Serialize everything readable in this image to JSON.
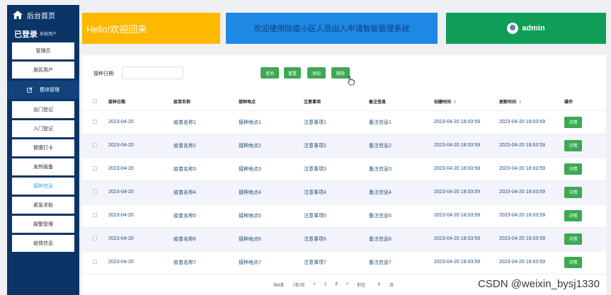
{
  "sidebar": {
    "home_label": "后台首页",
    "user_name": "已登录",
    "user_role": "系统用户",
    "items_top": [
      "管理员",
      "居民用户"
    ],
    "group_label": "模块管理",
    "items": [
      "出门登记",
      "入门登记",
      "健康打卡",
      "发热报备",
      "接种信息",
      "紧急求助",
      "报警管理",
      "疫情信息"
    ],
    "active_item": "接种信息"
  },
  "banners": {
    "hello": "Hello!欢迎回来",
    "welcome": "欢迎使用防疫小区人员出入申请智能管理系统",
    "admin": "admin"
  },
  "search": {
    "label": "接种日期:",
    "value": "",
    "buttons": [
      "查询",
      "重置",
      "添加",
      "删除"
    ]
  },
  "table": {
    "columns": [
      "接种日期",
      "疫苗名称",
      "接种地点",
      "注意事项",
      "备注信息",
      "创建时间",
      "更新时间",
      "操作"
    ],
    "sortable_suffix": "⇕",
    "rows": [
      [
        "2023-04-20",
        "疫苗名称1",
        "接种地点1",
        "注意事项1",
        "备注信息1",
        "2023-04-20 18:03:59",
        "2023-04-20 18:03:59"
      ],
      [
        "2023-04-20",
        "疫苗名称2",
        "接种地点2",
        "注意事项2",
        "备注信息2",
        "2023-04-20 18:03:59",
        "2023-04-20 18:03:59"
      ],
      [
        "2023-04-20",
        "疫苗名称3",
        "接种地点3",
        "注意事项3",
        "备注信息3",
        "2023-04-20 18:03:59",
        "2023-04-20 18:03:59"
      ],
      [
        "2023-04-20",
        "疫苗名称4",
        "接种地点4",
        "注意事项4",
        "备注信息4",
        "2023-04-20 18:03:59",
        "2023-04-20 18:03:59"
      ],
      [
        "2023-04-20",
        "疫苗名称5",
        "接种地点5",
        "注意事项5",
        "备注信息5",
        "2023-04-20 18:03:59",
        "2023-04-20 18:03:59"
      ],
      [
        "2023-04-20",
        "疫苗名称6",
        "接种地点6",
        "注意事项6",
        "备注信息6",
        "2023-04-20 18:03:59",
        "2023-04-20 18:03:59"
      ],
      [
        "2023-04-20",
        "疫苗名称7",
        "接种地点7",
        "注意事项7",
        "备注信息7",
        "2023-04-20 18:03:59",
        "2023-04-20 18:03:59"
      ]
    ],
    "action_label": "详情"
  },
  "pagination": {
    "total": "共8条",
    "page_size": "7条/页",
    "prev": "<",
    "pages": [
      "1",
      "2"
    ],
    "current": "2",
    "next": ">",
    "goto_label": "前往",
    "goto_value": "1",
    "page_unit": "页"
  },
  "watermark": "CSDN @weixin_bysj1330",
  "colors": {
    "sidebar": "#0b3566",
    "hello": "#ffb800",
    "welcome": "#1e88e5",
    "admin": "#0f9d58",
    "button": "#3ea852",
    "active": "#3ca0ff"
  }
}
